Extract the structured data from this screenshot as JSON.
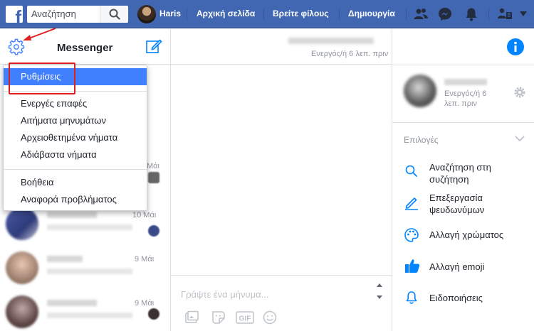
{
  "topbar": {
    "search_placeholder": "Αναζήτηση",
    "user_name": "Haris",
    "nav": {
      "home": "Αρχική σελίδα",
      "find_friends": "Βρείτε φίλους",
      "create": "Δημιουργία"
    },
    "brand_color": "#4267b2"
  },
  "left": {
    "title": "Messenger",
    "dropdown": {
      "settings": "Ρυθμίσεις",
      "active_contacts": "Ενεργές επαφές",
      "message_requests": "Αιτήματα μηνυμάτων",
      "archived_threads": "Αρχειοθετημένα νήματα",
      "unread_threads": "Αδιάβαστα νήματα",
      "help": "Βοήθεια",
      "report_problem": "Αναφορά προβλήματος"
    },
    "conversations": [
      {
        "date": "Μάι"
      },
      {
        "date": "10 Μάι"
      },
      {
        "date": "9 Μάι"
      },
      {
        "date": "9 Μάι"
      }
    ]
  },
  "middle": {
    "status": "Ενεργός/ή 6 λεπ. πριν",
    "composer_placeholder": "Γράψτε ένα μήνυμα..."
  },
  "right": {
    "status": "Ενεργός/ή 6 λεπ. πριν",
    "options_title": "Επιλογές",
    "options": {
      "search": "Αναζήτηση στη συζήτηση",
      "nicknames": "Επεξεργασία ψευδωνύμων",
      "color": "Αλλαγή χρώματος",
      "emoji": "Αλλαγή emoji",
      "notifications": "Ειδοποιήσεις"
    },
    "accent_color": "#0084ff"
  },
  "annotation_color": "#e02020"
}
